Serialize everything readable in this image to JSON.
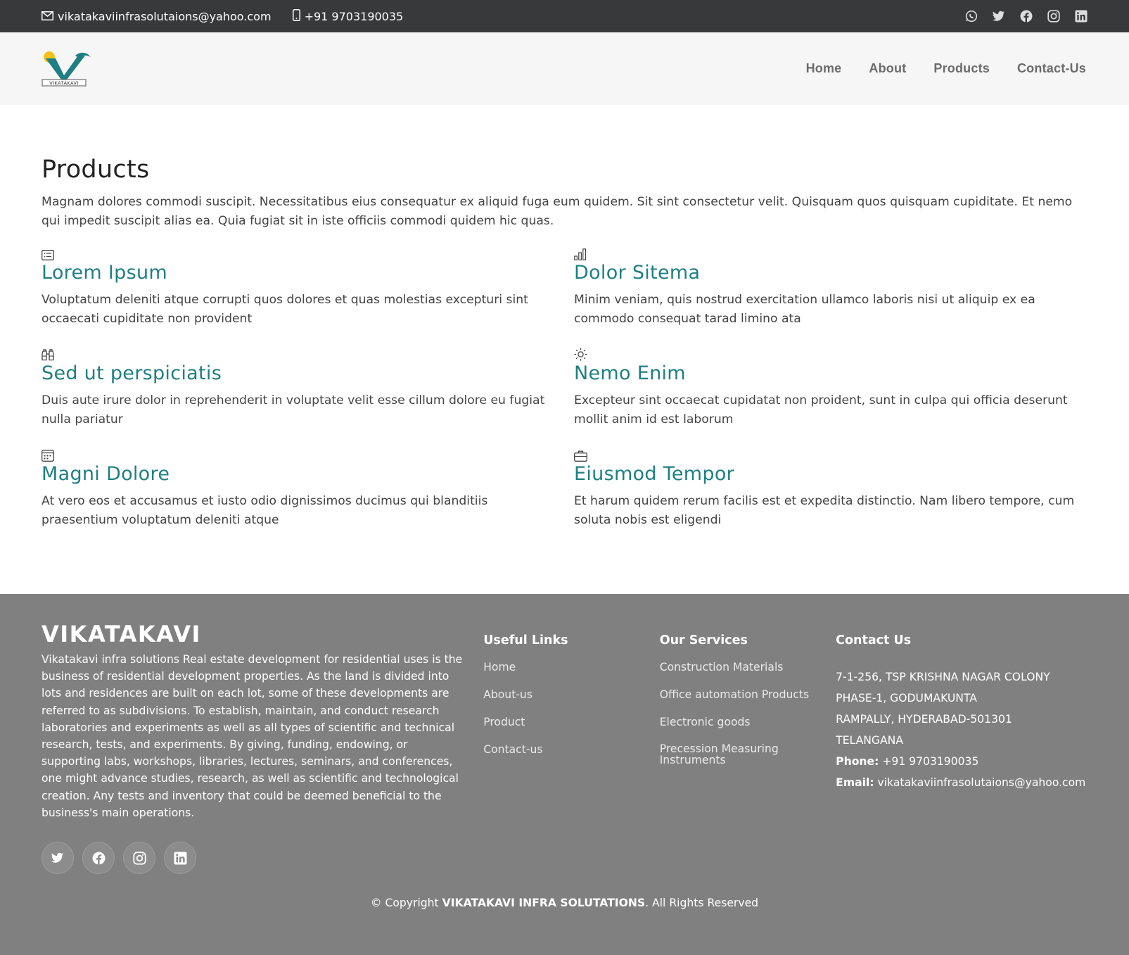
{
  "topbar": {
    "email": "vikatakaviinfrasolutaions@yahoo.com",
    "phone": "+91 9703190035",
    "icons": [
      "whatsapp-icon",
      "twitter-icon",
      "facebook-icon",
      "instagram-icon",
      "linkedin-icon"
    ]
  },
  "header": {
    "logo_text": "VIKATAKAVI",
    "nav": [
      "Home",
      "About",
      "Products",
      "Contact-Us"
    ]
  },
  "main": {
    "title": "Products",
    "intro": "Magnam dolores commodi suscipit. Necessitatibus eius consequatur ex aliquid fuga eum quidem. Sit sint consectetur velit. Quisquam quos quisquam cupiditate. Et nemo qui impedit suscipit alias ea. Quia fugiat sit in iste officiis commodi quidem hic quas.",
    "products": [
      {
        "icon": "card-list-icon",
        "title": "Lorem Ipsum",
        "text": "Voluptatum deleniti atque corrupti quos dolores et quas molestias excepturi sint occaecati cupiditate non provident"
      },
      {
        "icon": "bar-chart-icon",
        "title": "Dolor Sitema",
        "text": "Minim veniam, quis nostrud exercitation ullamco laboris nisi ut aliquip ex ea commodo consequat tarad limino ata"
      },
      {
        "icon": "binoculars-icon",
        "title": "Sed ut perspiciatis",
        "text": "Duis aute irure dolor in reprehenderit in voluptate velit esse cillum dolore eu fugiat nulla pariatur"
      },
      {
        "icon": "sun-icon",
        "title": "Nemo Enim",
        "text": "Excepteur sint occaecat cupidatat non proident, sunt in culpa qui officia deserunt mollit anim id est laborum"
      },
      {
        "icon": "calendar-icon",
        "title": "Magni Dolore",
        "text": "At vero eos et accusamus et iusto odio dignissimos ducimus qui blanditiis praesentium voluptatum deleniti atque"
      },
      {
        "icon": "briefcase-icon",
        "title": "Eiusmod Tempor",
        "text": "Et harum quidem rerum facilis est et expedita distinctio. Nam libero tempore, cum soluta nobis est eligendi"
      }
    ]
  },
  "footer": {
    "brand": "VIKATAKAVI",
    "about": "Vikatakavi infra solutions Real estate development for residential uses is the business of residential development properties. As the land is divided into lots and residences are built on each lot, some of these developments are referred to as subdivisions. To establish, maintain, and conduct research laboratories and experiments as well as all types of scientific and technical research, tests, and experiments. By giving, funding, endowing, or supporting labs, workshops, libraries, lectures, seminars, and conferences, one might advance studies, research, as well as scientific and technological creation. Any tests and inventory that could be deemed beneficial to the business's main operations.",
    "useful_links_title": "Useful Links",
    "useful_links": [
      "Home",
      "About-us",
      "Product",
      "Contact-us"
    ],
    "services_title": "Our Services",
    "services": [
      "Construction Materials",
      "Office automation Products",
      "Electronic goods"
    ],
    "service_last_line1": "Precession Measuring",
    "service_last_line2": "Instruments",
    "contact_title": "Contact Us",
    "address": [
      "7-1-256, TSP KRISHNA NAGAR COLONY",
      "PHASE-1, GODUMAKUNTA",
      "RAMPALLY, HYDERABAD-501301",
      "TELANGANA"
    ],
    "phone_label": "Phone:",
    "phone": "+91 9703190035",
    "email_label": "Email:",
    "email": "vikatakaviinfrasolutaions@yahoo.com",
    "social_icons": [
      "twitter-icon",
      "facebook-icon",
      "instagram-icon",
      "linkedin-icon"
    ],
    "copyright_prefix": "© Copyright",
    "copyright_brand": "VIKATAKAVI INFRA SOLUTATIONS",
    "copyright_suffix": ". All Rights Reserved"
  },
  "colors": {
    "topbar_bg": "#37393a",
    "header_bg": "#f7f6f7",
    "accent_teal": "#1e7f83",
    "footer_bg": "#808080"
  }
}
